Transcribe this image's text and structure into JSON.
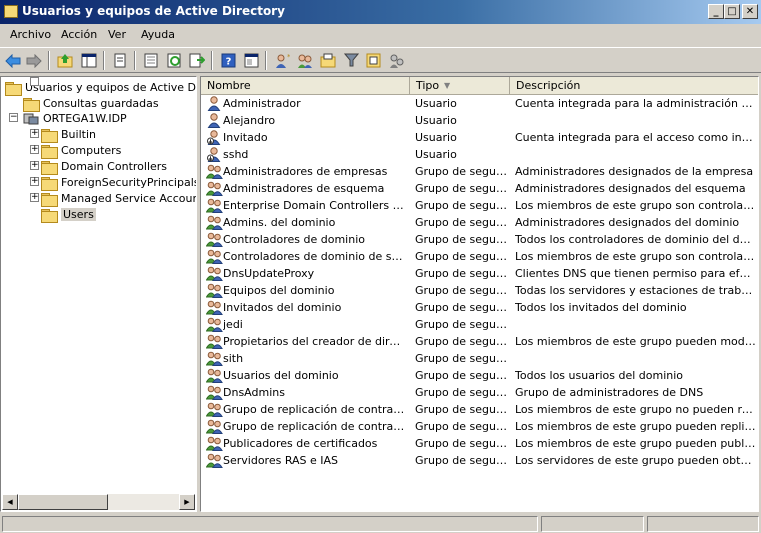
{
  "window": {
    "title": "Usuarios y equipos de Active Directory"
  },
  "menu": [
    "Archivo",
    "Acción",
    "Ver",
    "Ayuda"
  ],
  "toolbar": {
    "icons": [
      "back-arrow-icon",
      "forward-arrow-icon",
      "up-folder-icon",
      "show-tree-icon",
      "copy-icon",
      "properties-icon",
      "refresh-icon",
      "export-list-icon",
      "help-icon",
      "console-icon",
      "new-user-icon",
      "new-group-icon",
      "filter-icon",
      "add-to-group-icon",
      "delegate-icon"
    ]
  },
  "tree": {
    "root": "Usuarios y equipos de Active Directo",
    "saved_queries": "Consultas guardadas",
    "domain": "ORTEGA1W.IDP",
    "children": [
      "Builtin",
      "Computers",
      "Domain Controllers",
      "ForeignSecurityPrincipals",
      "Managed Service Accounts",
      "Users"
    ],
    "selected": "Users"
  },
  "list": {
    "columns": {
      "name": "Nombre",
      "type": "Tipo",
      "description": "Descripción"
    },
    "rows": [
      {
        "name": "Administrador",
        "type": "Usuario",
        "description": "Cuenta integrada para la administración del eq...",
        "icon": "user"
      },
      {
        "name": "Alejandro",
        "type": "Usuario",
        "description": "",
        "icon": "user"
      },
      {
        "name": "Invitado",
        "type": "Usuario",
        "description": "Cuenta integrada para el acceso como invitado...",
        "icon": "user-disabled"
      },
      {
        "name": "sshd",
        "type": "Usuario",
        "description": "",
        "icon": "user-disabled"
      },
      {
        "name": "Administradores de empresas",
        "type": "Grupo de seguri...",
        "description": "Administradores designados de la empresa",
        "icon": "group"
      },
      {
        "name": "Administradores de esquema",
        "type": "Grupo de seguri...",
        "description": "Administradores designados del esquema",
        "icon": "group"
      },
      {
        "name": "Enterprise Domain Controllers de só...",
        "type": "Grupo de seguri...",
        "description": "Los miembros de este grupo son controladores ...",
        "icon": "group"
      },
      {
        "name": "Admins. del dominio",
        "type": "Grupo de seguri...",
        "description": "Administradores designados del dominio",
        "icon": "group"
      },
      {
        "name": "Controladores de dominio",
        "type": "Grupo de seguri...",
        "description": "Todos los controladores de dominio del dominio",
        "icon": "group"
      },
      {
        "name": "Controladores de dominio de sólo le...",
        "type": "Grupo de seguri...",
        "description": "Los miembros de este grupo son controladores ...",
        "icon": "group"
      },
      {
        "name": "DnsUpdateProxy",
        "type": "Grupo de seguri...",
        "description": "Clientes DNS que tienen permiso para efectuar ...",
        "icon": "group"
      },
      {
        "name": "Equipos del dominio",
        "type": "Grupo de seguri...",
        "description": "Todas los servidores y estaciones de trabajo u...",
        "icon": "group"
      },
      {
        "name": "Invitados del dominio",
        "type": "Grupo de seguri...",
        "description": "Todos los invitados del dominio",
        "icon": "group"
      },
      {
        "name": "jedi",
        "type": "Grupo de seguri...",
        "description": "",
        "icon": "group"
      },
      {
        "name": "Propietarios del creador de directiv...",
        "type": "Grupo de seguri...",
        "description": "Los miembros de este grupo pueden modificar l...",
        "icon": "group"
      },
      {
        "name": "sith",
        "type": "Grupo de seguri...",
        "description": "",
        "icon": "group"
      },
      {
        "name": "Usuarios del dominio",
        "type": "Grupo de seguri...",
        "description": "Todos los usuarios del dominio",
        "icon": "group"
      },
      {
        "name": "DnsAdmins",
        "type": "Grupo de seguri...",
        "description": "Grupo de administradores de DNS",
        "icon": "group"
      },
      {
        "name": "Grupo de replicación de contraseña ...",
        "type": "Grupo de seguri...",
        "description": "Los miembros de este grupo no pueden replicar...",
        "icon": "group"
      },
      {
        "name": "Grupo de replicación de contraseña ...",
        "type": "Grupo de seguri...",
        "description": "Los miembros de este grupo pueden replicar las...",
        "icon": "group"
      },
      {
        "name": "Publicadores de certificados",
        "type": "Grupo de seguri...",
        "description": "Los miembros de este grupo pueden publicar ce...",
        "icon": "group"
      },
      {
        "name": "Servidores RAS e IAS",
        "type": "Grupo de seguri...",
        "description": "Los servidores de este grupo pueden obtener ...",
        "icon": "group"
      }
    ]
  },
  "colors": {
    "titlebar": "#0a246a",
    "selection": "#f6d977",
    "face": "#d4d0c8"
  }
}
